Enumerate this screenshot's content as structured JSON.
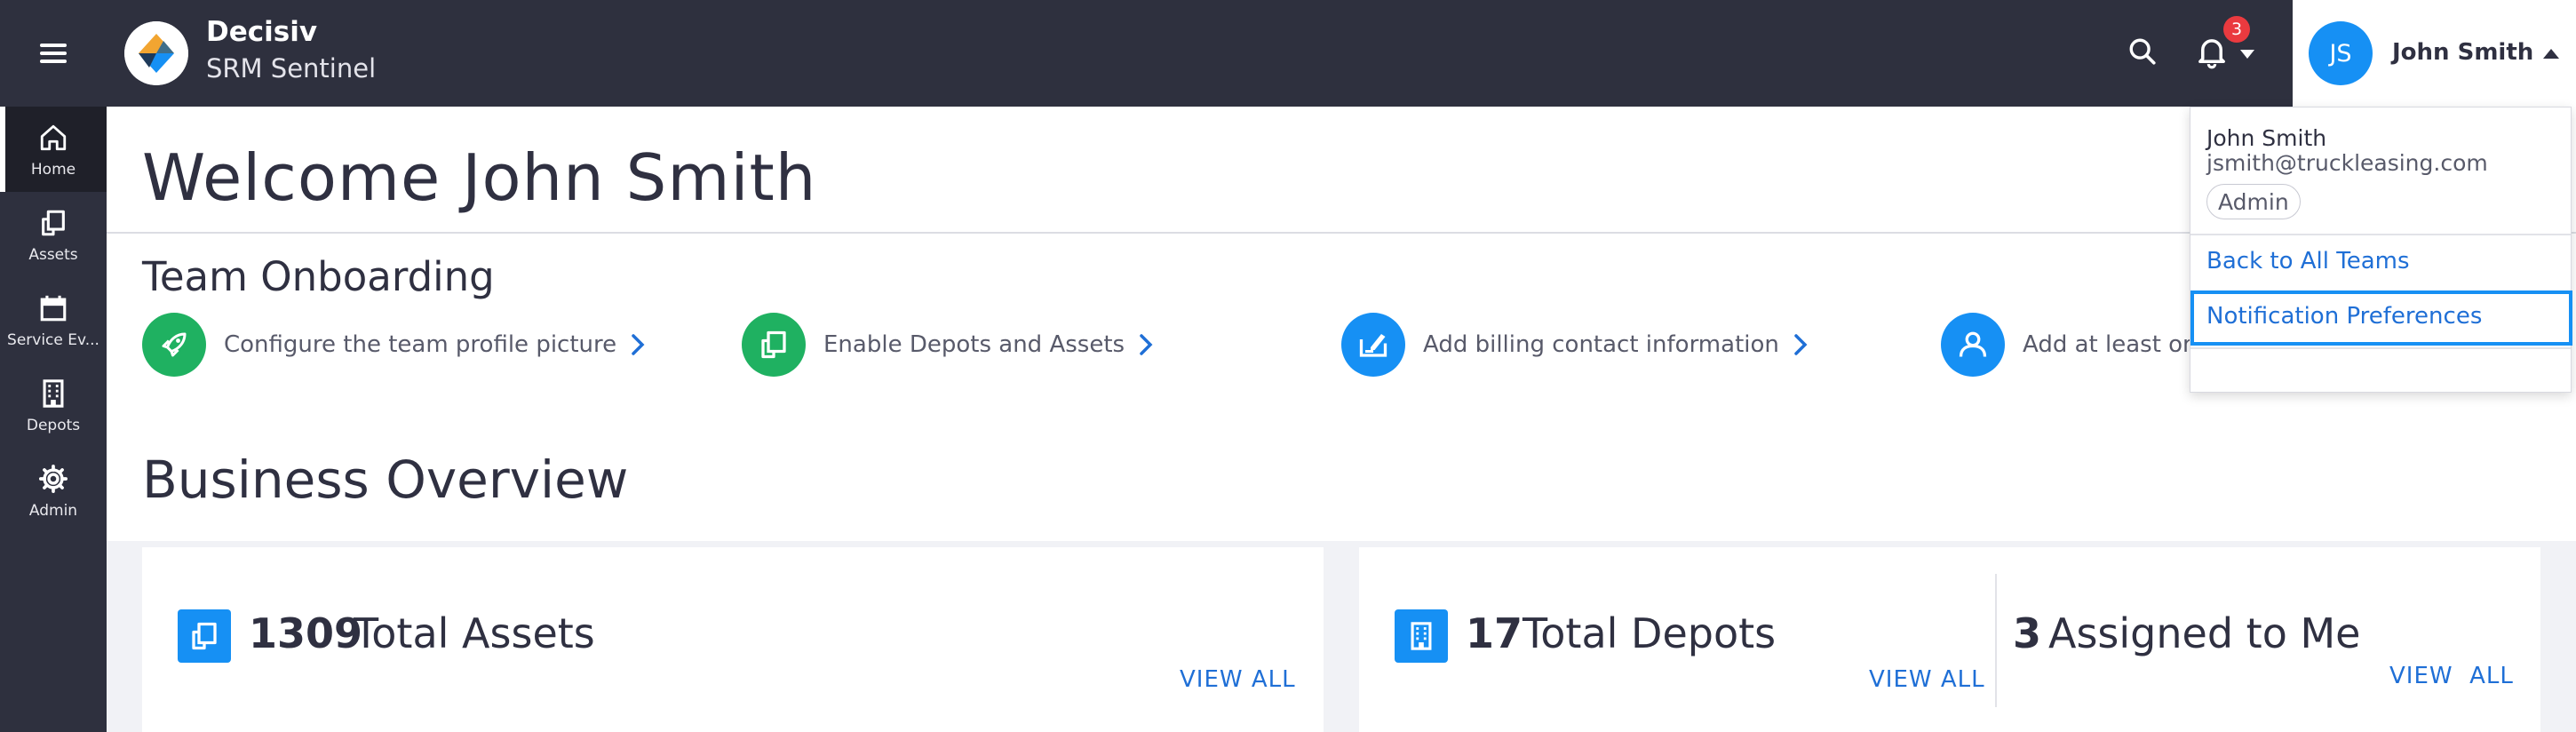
{
  "sidebar": {
    "items": [
      {
        "label": "Home",
        "icon": "home-icon"
      },
      {
        "label": "Assets",
        "icon": "asset-icon"
      },
      {
        "label": "Service Ev...",
        "icon": "calendar-icon"
      },
      {
        "label": "Depots",
        "icon": "building-icon"
      },
      {
        "label": "Admin",
        "icon": "gear-icon"
      }
    ]
  },
  "header": {
    "brand_name": "Decisiv",
    "brand_sub": "SRM Sentinel",
    "notification_count": "3",
    "user_initials": "JS",
    "user_name": "John Smith"
  },
  "user_menu": {
    "name": "John Smith",
    "email": "jsmith@truckleasing.com",
    "role": "Admin",
    "links": [
      "Back to All Teams",
      "Notification Preferences"
    ]
  },
  "welcome": {
    "title": "Welcome John Smith"
  },
  "onboarding": {
    "title": "Team Onboarding",
    "steps": [
      {
        "text": "Configure the team profile picture",
        "color": "#1fb161"
      },
      {
        "text": "Enable Depots and Assets",
        "color": "#1fb161"
      },
      {
        "text": "Add billing contact information",
        "color": "#1690f4"
      },
      {
        "text": "Add at least one",
        "color": "#1690f4"
      }
    ]
  },
  "business": {
    "title": "Business Overview",
    "cards": [
      {
        "count": "1309",
        "label": "Total Assets",
        "link": "VIEW ALL"
      },
      {
        "count": "17",
        "label": "Total Depots",
        "link": "VIEW ALL"
      },
      {
        "count": "3",
        "label": "Assigned to Me",
        "link": "VIEW  ALL"
      }
    ]
  },
  "colors": {
    "sidebar_bg": "#2e303e",
    "accent_blue": "#1690f4",
    "link_blue": "#1f6fd6",
    "green": "#1fb161",
    "badge_red": "#ea3a3f"
  }
}
